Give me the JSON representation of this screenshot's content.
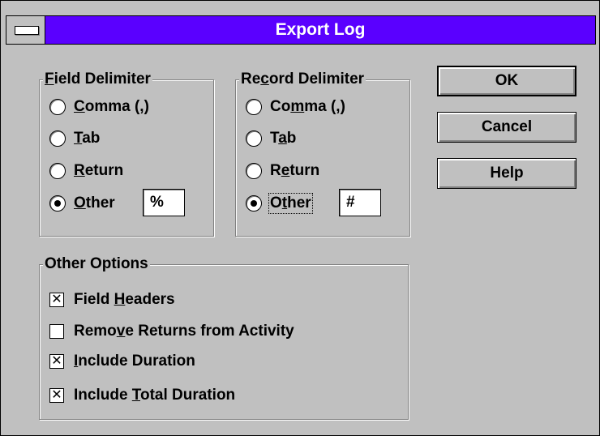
{
  "window": {
    "title": "Export Log"
  },
  "field_delimiter": {
    "legend": "Field Delimiter",
    "options": [
      {
        "label": "Comma (,)",
        "key": "C",
        "rest": "omma (,)",
        "pre": "",
        "selected": false
      },
      {
        "label": "Tab",
        "key": "T",
        "rest": "ab",
        "pre": "",
        "selected": false
      },
      {
        "label": "Return",
        "key": "R",
        "rest": "eturn",
        "pre": "",
        "selected": false
      },
      {
        "label": "Other",
        "key": "O",
        "rest": "ther",
        "pre": "",
        "selected": true
      }
    ],
    "other_value": "%"
  },
  "record_delimiter": {
    "legend": "Record Delimiter",
    "options": [
      {
        "label": "Comma (,)",
        "pre": "Co",
        "key": "m",
        "rest": "ma (,)",
        "selected": false
      },
      {
        "label": "Tab",
        "pre": "T",
        "key": "a",
        "rest": "b",
        "selected": false
      },
      {
        "label": "Return",
        "pre": "R",
        "key": "e",
        "rest": "turn",
        "selected": false
      },
      {
        "label": "Other",
        "pre": "O",
        "key": "t",
        "rest": "her",
        "selected": true
      }
    ],
    "other_value": "#"
  },
  "other_options": {
    "legend": "Other Options",
    "items": [
      {
        "pre": "Field ",
        "key": "H",
        "rest": "eaders",
        "checked": true
      },
      {
        "pre": "Remo",
        "key": "v",
        "rest": "e Returns from Activity",
        "checked": false
      },
      {
        "pre": "",
        "key": "I",
        "rest": "nclude Duration",
        "checked": true
      },
      {
        "pre": "Include ",
        "key": "T",
        "rest": "otal Duration",
        "checked": true
      }
    ]
  },
  "buttons": {
    "ok": "OK",
    "cancel": "Cancel",
    "help": "Help"
  },
  "check_mark": "✕"
}
